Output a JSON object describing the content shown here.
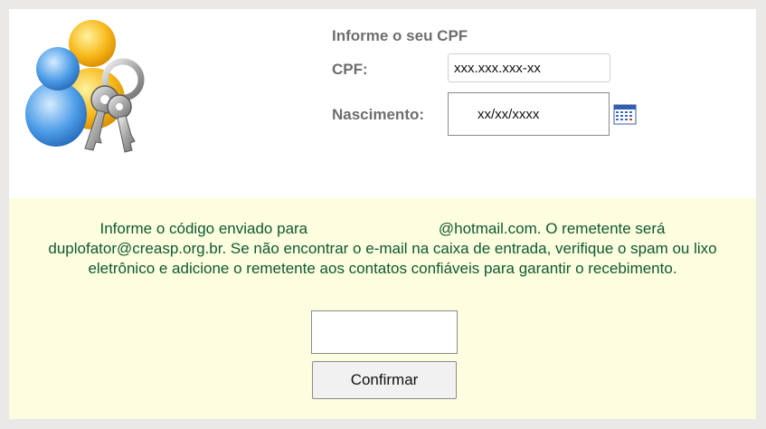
{
  "form": {
    "title": "Informe o seu CPF",
    "cpf_label": "CPF:",
    "cpf_value": "xxx.xxx.xxx-xx",
    "birth_label": "Nascimento:",
    "birth_value": "xx/xx/xxxx"
  },
  "verification": {
    "message_part1": "Informe o código enviado para",
    "message_part2": "@hotmail.com. O remetente será duplofator@creasp.org.br. Se não encontrar o e-mail na caixa de entrada, verifique o spam ou lixo eletrônico e adicione o remetente aos contatos confiáveis para garantir o recebimento.",
    "code_value": "",
    "confirm_label": "Confirmar"
  },
  "colors": {
    "label_gray": "#6e6e6e",
    "message_green": "#0f5a2e",
    "panel_yellow": "#fdfde0"
  },
  "icons": {
    "logo": "users-keys-icon",
    "calendar": "calendar-icon"
  }
}
